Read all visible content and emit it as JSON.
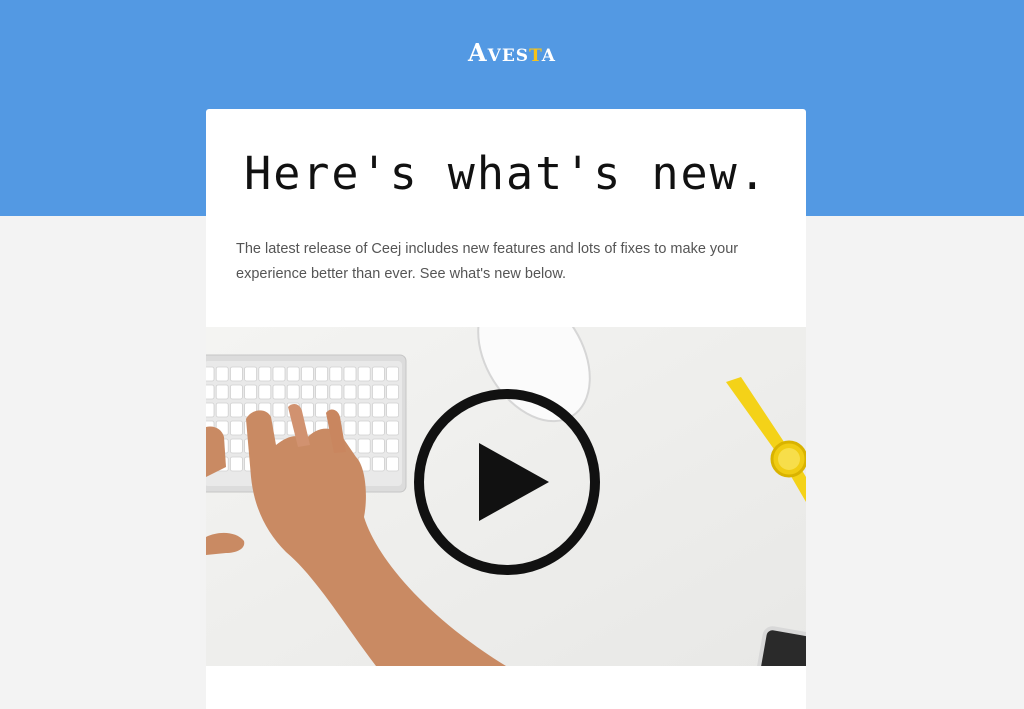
{
  "header": {
    "logo": {
      "first": "A",
      "part1": "VES",
      "gold": "T",
      "part2": "A",
      "color_bg": "#5399e3",
      "color_accent": "#f5c21b"
    }
  },
  "card": {
    "headline": "Here's what's new.",
    "intro": "The latest release of Ceej includes new features and lots of fixes to make your experience better than ever. See what's new below.",
    "video": {
      "icon": "play-icon"
    }
  }
}
